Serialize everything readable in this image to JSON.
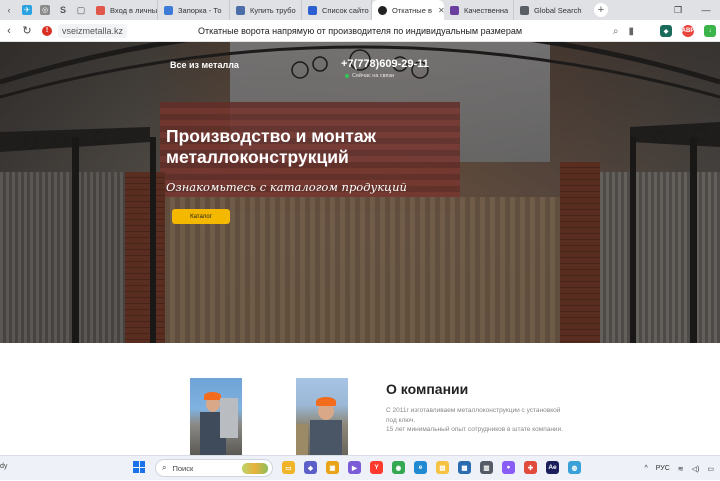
{
  "browser": {
    "tabs": [
      {
        "label": "Вход в личны",
        "color": "#e2574c"
      },
      {
        "label": "Запорка - То",
        "color": "#3d7bd9"
      },
      {
        "label": "Купить трубо",
        "color": "#4b6ea8"
      },
      {
        "label": "Список сайто",
        "color": "#2c5fcf"
      },
      {
        "label": "Откатные в",
        "color": "#222222",
        "active": true
      },
      {
        "label": "Качественна",
        "color": "#6b3fa0"
      },
      {
        "label": "Global Search",
        "color": "#5a5f66"
      }
    ],
    "pinned": [
      "telegram-icon",
      "whatsapp-icon",
      "s-icon",
      "doc-icon"
    ],
    "pinned_letters": [
      "‹",
      "✈",
      "◎",
      "S",
      "▢"
    ],
    "url": "vseizmetalla.kz",
    "page_title": "Откатные ворота напрямую от производителя по индивидуальным размерам",
    "ext_adblock": "ABP"
  },
  "site": {
    "brand": "Все из металла",
    "phone": "+7(778)609-29-11",
    "call_status": "Сейчас на связи",
    "hero_title_line1": "Производство и монтаж",
    "hero_title_line2": "металлоконструкций",
    "hero_subtitle": "Ознакомьтесь с каталогом продукций",
    "catalog_button": "Каталог",
    "about_title": "О компании",
    "about_text_1": "С 2011г изготавливаем металлоконструкции с установкой под ключ.",
    "about_text_2": "15 лет минимальный опыт сотрудников в штате компании."
  },
  "taskbar": {
    "left_text": "dy",
    "search_label": "Поиск",
    "lang": "РУС",
    "apps": [
      {
        "name": "files-icon",
        "color": "#f0b429",
        "glyph": "▭"
      },
      {
        "name": "teams-icon",
        "color": "#5b5fc7",
        "glyph": "◆"
      },
      {
        "name": "folder-icon",
        "color": "#e8a317",
        "glyph": "▣"
      },
      {
        "name": "video-icon",
        "color": "#7b5cd6",
        "glyph": "▶"
      },
      {
        "name": "yandex-icon",
        "color": "#ff3b30",
        "glyph": "Y"
      },
      {
        "name": "chrome-icon",
        "color": "#34a853",
        "glyph": "◉"
      },
      {
        "name": "edge-icon",
        "color": "#1f8ad2",
        "glyph": "e"
      },
      {
        "name": "explorer-icon",
        "color": "#f5c242",
        "glyph": "▤"
      },
      {
        "name": "store-icon",
        "color": "#2b6cb0",
        "glyph": "▦"
      },
      {
        "name": "calculator-icon",
        "color": "#555b66",
        "glyph": "▥"
      },
      {
        "name": "alice-icon",
        "color": "#8a5cf6",
        "glyph": "●"
      },
      {
        "name": "puzzle-icon",
        "color": "#e04b3c",
        "glyph": "✚"
      },
      {
        "name": "ae-icon",
        "color": "#1a1f5c",
        "glyph": "Ae"
      },
      {
        "name": "globe-icon",
        "color": "#3aa0d8",
        "glyph": "◍"
      }
    ]
  },
  "colors": {
    "accent_button": "#f5b800",
    "online_dot": "#34c759"
  }
}
